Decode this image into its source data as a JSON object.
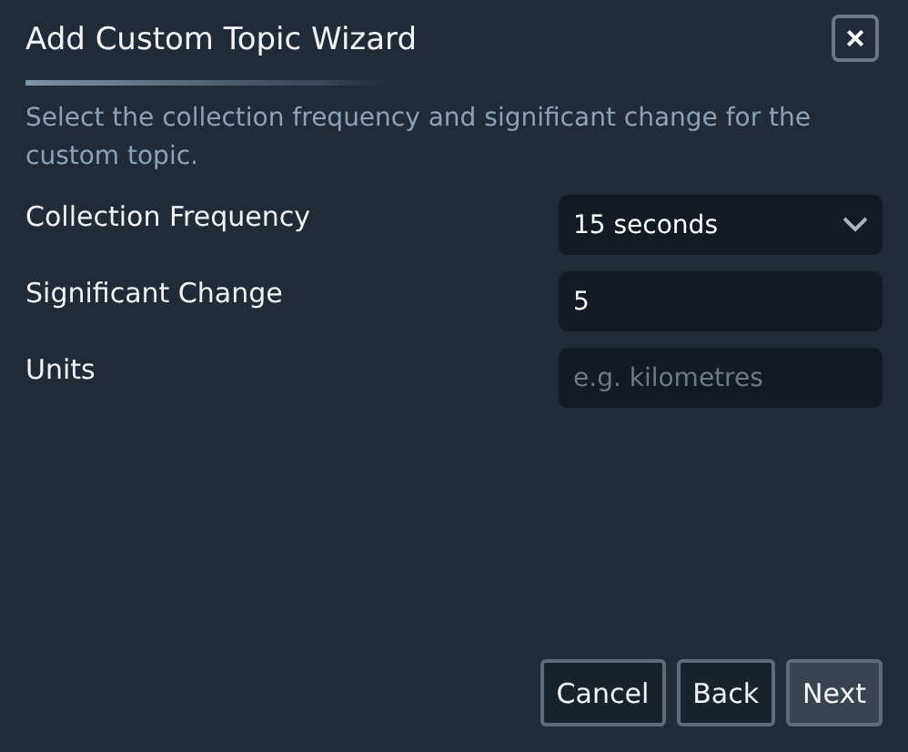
{
  "dialog": {
    "title": "Add Custom Topic Wizard",
    "close": "×"
  },
  "description": "Select the collection frequency and significant change for the custom topic.",
  "fields": [
    {
      "label": "Collection Frequency",
      "kind": "select",
      "value": "15 seconds"
    },
    {
      "label": "Significant Change",
      "kind": "text",
      "value": "5"
    },
    {
      "label": "Units",
      "kind": "text",
      "placeholder": "e.g. kilometres"
    }
  ],
  "buttons": [
    {
      "label": "Cancel",
      "hovered": false
    },
    {
      "label": "Back",
      "hovered": false
    },
    {
      "label": "Next",
      "hovered": true
    }
  ]
}
